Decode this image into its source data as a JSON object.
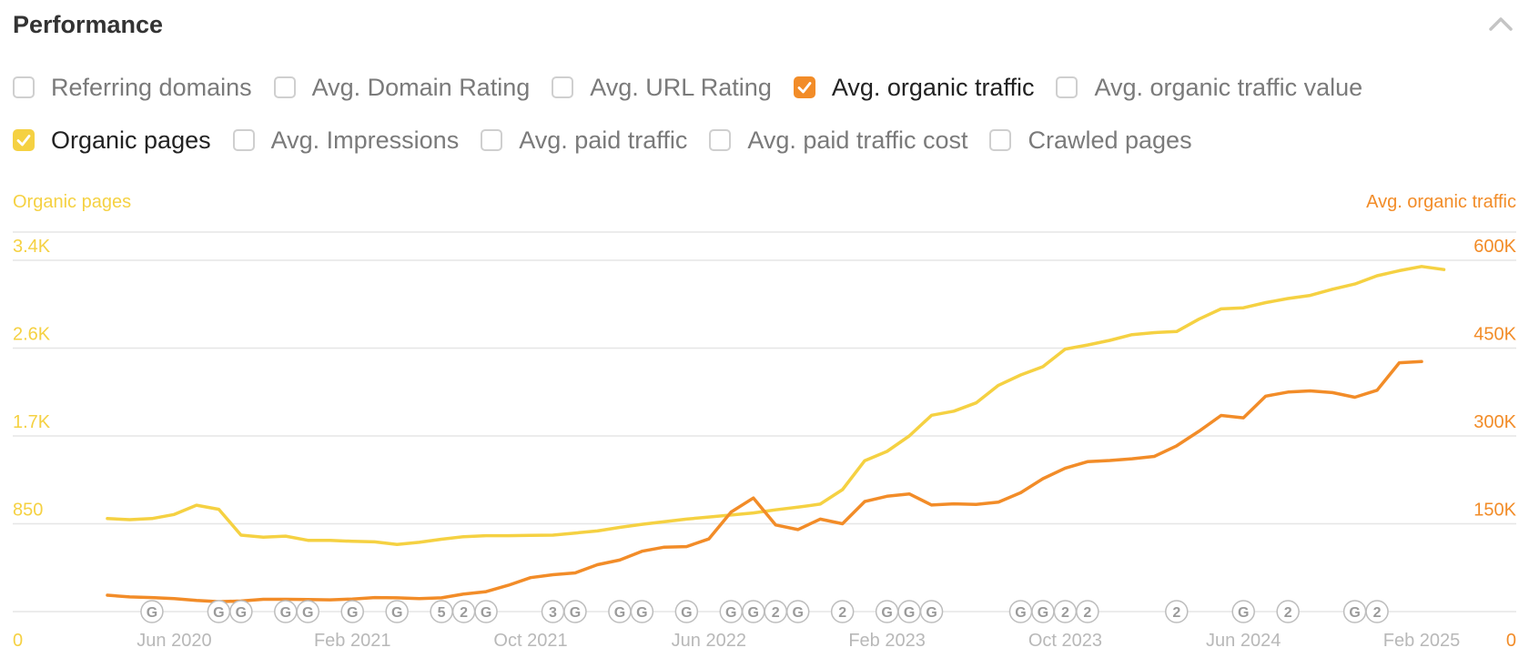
{
  "panel": {
    "title": "Performance"
  },
  "icons": {
    "collapse": "chevron-up-icon",
    "check": "check-icon"
  },
  "colors": {
    "organic_pages": "#f5d142",
    "organic_traffic": "#f28c28",
    "checkbox_border": "#cfcfcf",
    "grid": "#e6e6e6",
    "axis_text": "#b8b8b8"
  },
  "metrics": [
    {
      "id": "referring-domains",
      "label": "Referring domains",
      "checked": false,
      "row": 0
    },
    {
      "id": "avg-domain-rating",
      "label": "Avg. Domain Rating",
      "checked": false,
      "row": 0
    },
    {
      "id": "avg-url-rating",
      "label": "Avg. URL Rating",
      "checked": false,
      "row": 0
    },
    {
      "id": "avg-organic-traffic",
      "label": "Avg. organic traffic",
      "checked": true,
      "color": "#f28c28",
      "row": 0
    },
    {
      "id": "avg-organic-traffic-value",
      "label": "Avg. organic traffic value",
      "checked": false,
      "row": 0
    },
    {
      "id": "organic-pages",
      "label": "Organic pages",
      "checked": true,
      "color": "#f5d142",
      "row": 1
    },
    {
      "id": "avg-impressions",
      "label": "Avg. Impressions",
      "checked": false,
      "row": 1
    },
    {
      "id": "avg-paid-traffic",
      "label": "Avg. paid traffic",
      "checked": false,
      "row": 1
    },
    {
      "id": "avg-paid-traffic-cost",
      "label": "Avg. paid traffic cost",
      "checked": false,
      "row": 1
    },
    {
      "id": "crawled-pages",
      "label": "Crawled pages",
      "checked": false,
      "row": 1
    }
  ],
  "chart_data": {
    "type": "line",
    "x_start": "Mar 2020",
    "x_end": "Feb 2025",
    "x_ticks": [
      {
        "label": "Jun 2020",
        "month": "2020-06"
      },
      {
        "label": "Feb 2021",
        "month": "2021-02"
      },
      {
        "label": "Oct 2021",
        "month": "2021-10"
      },
      {
        "label": "Jun 2022",
        "month": "2022-06"
      },
      {
        "label": "Feb 2023",
        "month": "2023-02"
      },
      {
        "label": "Oct 2023",
        "month": "2023-10"
      },
      {
        "label": "Jun 2024",
        "month": "2024-06"
      },
      {
        "label": "Feb 2025",
        "month": "2025-02"
      }
    ],
    "y_left": {
      "label": "Organic pages",
      "range": [
        0,
        3400
      ],
      "ticks": [
        {
          "label": "0",
          "value": 0
        },
        {
          "label": "850",
          "value": 850
        },
        {
          "label": "1.7K",
          "value": 1700
        },
        {
          "label": "2.6K",
          "value": 2550
        },
        {
          "label": "3.4K",
          "value": 3400
        }
      ]
    },
    "y_right": {
      "label": "Avg. organic traffic",
      "range": [
        0,
        600000
      ],
      "ticks": [
        {
          "label": "0",
          "value": 0
        },
        {
          "label": "150K",
          "value": 150000
        },
        {
          "label": "300K",
          "value": 300000
        },
        {
          "label": "450K",
          "value": 450000
        },
        {
          "label": "600K",
          "value": 600000
        }
      ]
    },
    "grid": true,
    "series": [
      {
        "name": "Organic pages",
        "axis": "left",
        "color": "#f5d142",
        "points": [
          [
            "2020-03",
            900
          ],
          [
            "2020-04",
            890
          ],
          [
            "2020-05",
            900
          ],
          [
            "2020-06",
            940
          ],
          [
            "2020-07",
            1030
          ],
          [
            "2020-08",
            990
          ],
          [
            "2020-09",
            740
          ],
          [
            "2020-10",
            720
          ],
          [
            "2020-11",
            730
          ],
          [
            "2020-12",
            690
          ],
          [
            "2021-01",
            690
          ],
          [
            "2021-02",
            680
          ],
          [
            "2021-03",
            675
          ],
          [
            "2021-04",
            650
          ],
          [
            "2021-05",
            670
          ],
          [
            "2021-06",
            700
          ],
          [
            "2021-07",
            725
          ],
          [
            "2021-08",
            735
          ],
          [
            "2021-09",
            735
          ],
          [
            "2021-10",
            738
          ],
          [
            "2021-11",
            740
          ],
          [
            "2021-12",
            760
          ],
          [
            "2022-01",
            780
          ],
          [
            "2022-02",
            815
          ],
          [
            "2022-03",
            845
          ],
          [
            "2022-04",
            870
          ],
          [
            "2022-05",
            895
          ],
          [
            "2022-06",
            915
          ],
          [
            "2022-07",
            935
          ],
          [
            "2022-08",
            955
          ],
          [
            "2022-09",
            985
          ],
          [
            "2022-10",
            1010
          ],
          [
            "2022-11",
            1040
          ],
          [
            "2022-12",
            1180
          ],
          [
            "2023-01",
            1460
          ],
          [
            "2023-02",
            1550
          ],
          [
            "2023-03",
            1700
          ],
          [
            "2023-04",
            1900
          ],
          [
            "2023-05",
            1940
          ],
          [
            "2023-06",
            2020
          ],
          [
            "2023-07",
            2190
          ],
          [
            "2023-08",
            2290
          ],
          [
            "2023-09",
            2370
          ],
          [
            "2023-10",
            2540
          ],
          [
            "2023-11",
            2580
          ],
          [
            "2023-12",
            2625
          ],
          [
            "2024-01",
            2680
          ],
          [
            "2024-02",
            2700
          ],
          [
            "2024-03",
            2710
          ],
          [
            "2024-04",
            2830
          ],
          [
            "2024-05",
            2930
          ],
          [
            "2024-06",
            2940
          ],
          [
            "2024-07",
            2990
          ],
          [
            "2024-08",
            3030
          ],
          [
            "2024-09",
            3060
          ],
          [
            "2024-10",
            3120
          ],
          [
            "2024-11",
            3170
          ],
          [
            "2024-12",
            3250
          ],
          [
            "2025-01",
            3300
          ],
          [
            "2025-02",
            3340
          ],
          [
            "2025-03",
            3310
          ]
        ]
      },
      {
        "name": "Avg. organic traffic",
        "axis": "right",
        "color": "#f28c28",
        "points": [
          [
            "2020-03",
            28000
          ],
          [
            "2020-04",
            25000
          ],
          [
            "2020-05",
            24000
          ],
          [
            "2020-06",
            22000
          ],
          [
            "2020-07",
            19000
          ],
          [
            "2020-08",
            17000
          ],
          [
            "2020-09",
            18000
          ],
          [
            "2020-10",
            21000
          ],
          [
            "2020-11",
            21000
          ],
          [
            "2020-12",
            20500
          ],
          [
            "2021-01",
            20000
          ],
          [
            "2021-02",
            21500
          ],
          [
            "2021-03",
            24000
          ],
          [
            "2021-04",
            23500
          ],
          [
            "2021-05",
            22000
          ],
          [
            "2021-06",
            23500
          ],
          [
            "2021-07",
            30000
          ],
          [
            "2021-08",
            34000
          ],
          [
            "2021-09",
            45000
          ],
          [
            "2021-10",
            58000
          ],
          [
            "2021-11",
            63000
          ],
          [
            "2021-12",
            66000
          ],
          [
            "2022-01",
            80000
          ],
          [
            "2022-02",
            88000
          ],
          [
            "2022-03",
            103000
          ],
          [
            "2022-04",
            110000
          ],
          [
            "2022-05",
            111000
          ],
          [
            "2022-06",
            124000
          ],
          [
            "2022-07",
            170000
          ],
          [
            "2022-08",
            194000
          ],
          [
            "2022-09",
            148000
          ],
          [
            "2022-10",
            140000
          ],
          [
            "2022-11",
            158000
          ],
          [
            "2022-12",
            150000
          ],
          [
            "2023-01",
            188000
          ],
          [
            "2023-02",
            197000
          ],
          [
            "2023-03",
            201000
          ],
          [
            "2023-04",
            182000
          ],
          [
            "2023-05",
            184000
          ],
          [
            "2023-06",
            183000
          ],
          [
            "2023-07",
            187000
          ],
          [
            "2023-08",
            203000
          ],
          [
            "2023-09",
            227000
          ],
          [
            "2023-10",
            245000
          ],
          [
            "2023-11",
            256000
          ],
          [
            "2023-12",
            258000
          ],
          [
            "2024-01",
            261000
          ],
          [
            "2024-02",
            265000
          ],
          [
            "2024-03",
            283000
          ],
          [
            "2024-04",
            308000
          ],
          [
            "2024-05",
            335000
          ],
          [
            "2024-06",
            331000
          ],
          [
            "2024-07",
            368000
          ],
          [
            "2024-08",
            375000
          ],
          [
            "2024-09",
            377000
          ],
          [
            "2024-10",
            374000
          ],
          [
            "2024-11",
            366000
          ],
          [
            "2024-12",
            378000
          ],
          [
            "2025-01",
            425000
          ],
          [
            "2025-02",
            427000
          ]
        ]
      }
    ],
    "annotations": [
      {
        "month": "2020-05",
        "label": "G"
      },
      {
        "month": "2020-08",
        "label": "G"
      },
      {
        "month": "2020-09",
        "label": "G"
      },
      {
        "month": "2020-11",
        "label": "G"
      },
      {
        "month": "2020-12",
        "label": "G"
      },
      {
        "month": "2021-02",
        "label": "G"
      },
      {
        "month": "2021-04",
        "label": "G"
      },
      {
        "month": "2021-06",
        "label": "5"
      },
      {
        "month": "2021-07",
        "label": "2"
      },
      {
        "month": "2021-08",
        "label": "G"
      },
      {
        "month": "2021-11",
        "label": "3"
      },
      {
        "month": "2021-12",
        "label": "G"
      },
      {
        "month": "2022-02",
        "label": "G"
      },
      {
        "month": "2022-03",
        "label": "G"
      },
      {
        "month": "2022-05",
        "label": "G"
      },
      {
        "month": "2022-07",
        "label": "G"
      },
      {
        "month": "2022-08",
        "label": "G"
      },
      {
        "month": "2022-09",
        "label": "2"
      },
      {
        "month": "2022-10",
        "label": "G"
      },
      {
        "month": "2022-12",
        "label": "2"
      },
      {
        "month": "2023-02",
        "label": "G"
      },
      {
        "month": "2023-03",
        "label": "G"
      },
      {
        "month": "2023-04",
        "label": "G"
      },
      {
        "month": "2023-08",
        "label": "G"
      },
      {
        "month": "2023-09",
        "label": "G"
      },
      {
        "month": "2023-10",
        "label": "2"
      },
      {
        "month": "2023-11",
        "label": "2"
      },
      {
        "month": "2024-03",
        "label": "2"
      },
      {
        "month": "2024-06",
        "label": "G"
      },
      {
        "month": "2024-08",
        "label": "2"
      },
      {
        "month": "2024-11",
        "label": "G"
      },
      {
        "month": "2024-12",
        "label": "2"
      }
    ]
  }
}
